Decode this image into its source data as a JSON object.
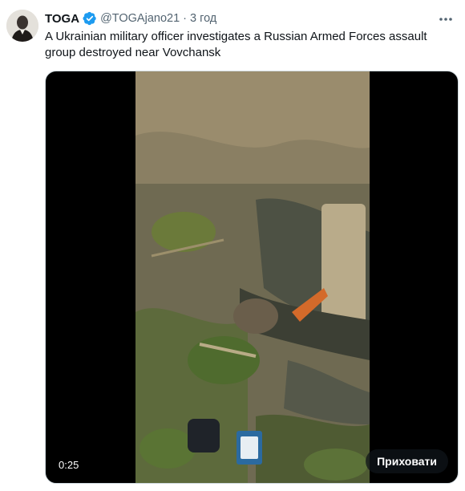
{
  "author": {
    "display_name": "TOGA",
    "handle": "@TOGAjano21",
    "separator": "·",
    "time": "3 год",
    "verified_icon": "verified-badge-icon",
    "avatar_icon": "avatar-portrait"
  },
  "tweet": {
    "text": "A Ukrainian military officer investigates a Russian Armed Forces assault group destroyed near Vovchansk"
  },
  "media": {
    "duration": "0:25",
    "hide_label": "Приховати"
  },
  "colors": {
    "accent": "#1d9bf0",
    "text": "#0f1419",
    "secondary": "#536471"
  }
}
